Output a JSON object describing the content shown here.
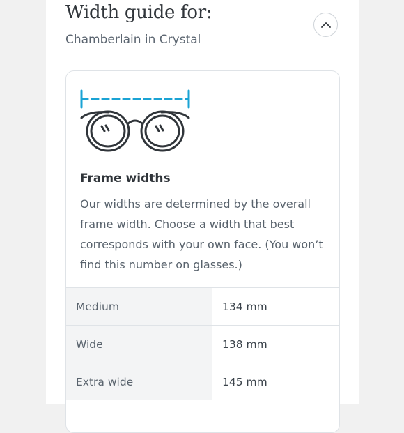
{
  "header": {
    "title": "Width guide for:",
    "subtitle": "Chamberlain in Crystal"
  },
  "icons": {
    "collapse": "chevron-up-icon",
    "illustration": "glasses-width-icon",
    "accent_color": "#1aa3d4"
  },
  "info": {
    "heading": "Frame widths",
    "description": "Our widths are determined by the overall frame width. Choose a width that best corresponds with your own face. (You won’t find this number on glasses.)"
  },
  "widths": [
    {
      "size": "Medium",
      "value": "134 mm"
    },
    {
      "size": "Wide",
      "value": "138 mm"
    },
    {
      "size": "Extra wide",
      "value": "145 mm"
    }
  ]
}
